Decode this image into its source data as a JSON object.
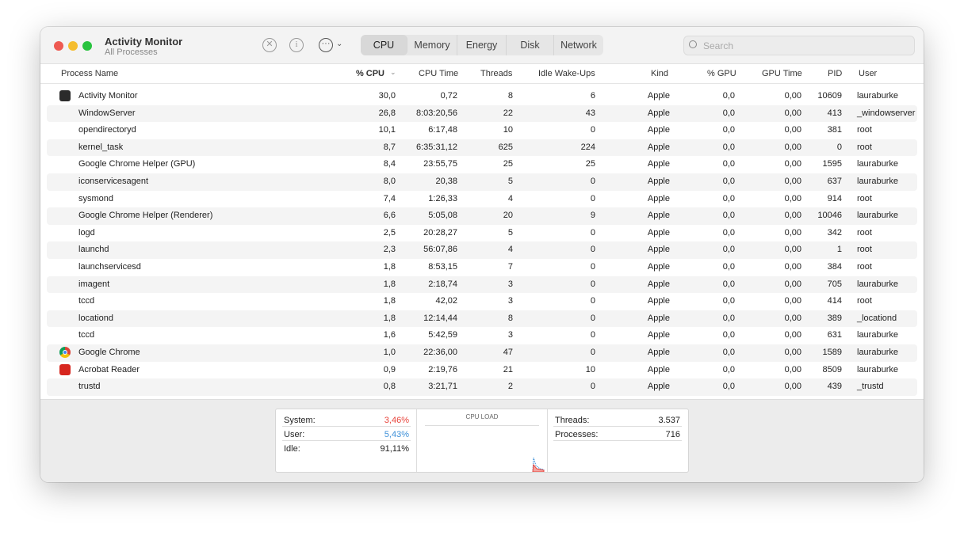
{
  "window": {
    "title": "Activity Monitor",
    "subtitle": "All Processes"
  },
  "toolbar": {
    "stop_icon": "x-circle-icon",
    "info_icon": "info-icon",
    "more_icon": "ellipsis-circle-icon"
  },
  "tabs": [
    "CPU",
    "Memory",
    "Energy",
    "Disk",
    "Network"
  ],
  "search": {
    "placeholder": "Search"
  },
  "columns": [
    "Process Name",
    "% CPU",
    "CPU Time",
    "Threads",
    "Idle Wake-Ups",
    "Kind",
    "% GPU",
    "GPU Time",
    "PID",
    "User"
  ],
  "rows": [
    [
      "Activity Monitor",
      "30,0",
      "0,72",
      "8",
      "6",
      "Apple",
      "0,0",
      "0,00",
      "10609",
      "lauraburke"
    ],
    [
      "WindowServer",
      "26,8",
      "8:03:20,56",
      "22",
      "43",
      "Apple",
      "0,0",
      "0,00",
      "413",
      "_windowserver"
    ],
    [
      "opendirectoryd",
      "10,1",
      "6:17,48",
      "10",
      "0",
      "Apple",
      "0,0",
      "0,00",
      "381",
      "root"
    ],
    [
      "kernel_task",
      "8,7",
      "6:35:31,12",
      "625",
      "224",
      "Apple",
      "0,0",
      "0,00",
      "0",
      "root"
    ],
    [
      "Google Chrome Helper (GPU)",
      "8,4",
      "23:55,75",
      "25",
      "25",
      "Apple",
      "0,0",
      "0,00",
      "1595",
      "lauraburke"
    ],
    [
      "iconservicesagent",
      "8,0",
      "20,38",
      "5",
      "0",
      "Apple",
      "0,0",
      "0,00",
      "637",
      "lauraburke"
    ],
    [
      "sysmond",
      "7,4",
      "1:26,33",
      "4",
      "0",
      "Apple",
      "0,0",
      "0,00",
      "914",
      "root"
    ],
    [
      "Google Chrome Helper (Renderer)",
      "6,6",
      "5:05,08",
      "20",
      "9",
      "Apple",
      "0,0",
      "0,00",
      "10046",
      "lauraburke"
    ],
    [
      "logd",
      "2,5",
      "20:28,27",
      "5",
      "0",
      "Apple",
      "0,0",
      "0,00",
      "342",
      "root"
    ],
    [
      "launchd",
      "2,3",
      "56:07,86",
      "4",
      "0",
      "Apple",
      "0,0",
      "0,00",
      "1",
      "root"
    ],
    [
      "launchservicesd",
      "1,8",
      "8:53,15",
      "7",
      "0",
      "Apple",
      "0,0",
      "0,00",
      "384",
      "root"
    ],
    [
      "imagent",
      "1,8",
      "2:18,74",
      "3",
      "0",
      "Apple",
      "0,0",
      "0,00",
      "705",
      "lauraburke"
    ],
    [
      "tccd",
      "1,8",
      "42,02",
      "3",
      "0",
      "Apple",
      "0,0",
      "0,00",
      "414",
      "root"
    ],
    [
      "locationd",
      "1,8",
      "12:14,44",
      "8",
      "0",
      "Apple",
      "0,0",
      "0,00",
      "389",
      "_locationd"
    ],
    [
      "tccd",
      "1,6",
      "5:42,59",
      "3",
      "0",
      "Apple",
      "0,0",
      "0,00",
      "631",
      "lauraburke"
    ],
    [
      "Google Chrome",
      "1,0",
      "22:36,00",
      "47",
      "0",
      "Apple",
      "0,0",
      "0,00",
      "1589",
      "lauraburke"
    ],
    [
      "Acrobat Reader",
      "0,9",
      "2:19,76",
      "21",
      "10",
      "Apple",
      "0,0",
      "0,00",
      "8509",
      "lauraburke"
    ],
    [
      "trustd",
      "0,8",
      "3:21,71",
      "2",
      "0",
      "Apple",
      "0,0",
      "0,00",
      "439",
      "_trustd"
    ]
  ],
  "row_icons": {
    "0": "activity-monitor-icon",
    "15": "chrome-icon",
    "16": "acrobat-icon"
  },
  "summary": {
    "system_label": "System:",
    "system_value": "3,46%",
    "user_label": "User:",
    "user_value": "5,43%",
    "idle_label": "Idle:",
    "idle_value": "91,11%",
    "cpu_load_title": "CPU LOAD",
    "threads_label": "Threads:",
    "threads_value": "3.537",
    "processes_label": "Processes:",
    "processes_value": "716"
  },
  "colors": {
    "system": "#e8453c",
    "user": "#3c8fd8"
  }
}
